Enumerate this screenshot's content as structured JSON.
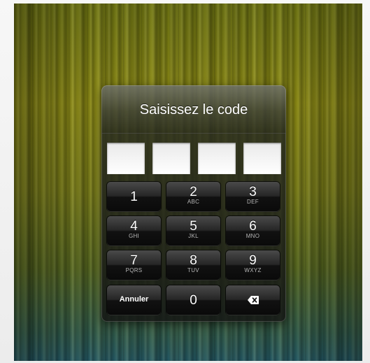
{
  "dialog": {
    "title": "Saisissez le code"
  },
  "code_fields": [
    {
      "value": ""
    },
    {
      "value": ""
    },
    {
      "value": ""
    },
    {
      "value": ""
    }
  ],
  "keypad": {
    "keys": [
      {
        "digit": "1",
        "letters": ""
      },
      {
        "digit": "2",
        "letters": "ABC"
      },
      {
        "digit": "3",
        "letters": "DEF"
      },
      {
        "digit": "4",
        "letters": "GHI"
      },
      {
        "digit": "5",
        "letters": "JKL"
      },
      {
        "digit": "6",
        "letters": "MNO"
      },
      {
        "digit": "7",
        "letters": "PQRS"
      },
      {
        "digit": "8",
        "letters": "TUV"
      },
      {
        "digit": "9",
        "letters": "WXYZ"
      }
    ],
    "cancel_label": "Annuler",
    "zero_digit": "0",
    "delete_icon": "backspace-icon"
  }
}
